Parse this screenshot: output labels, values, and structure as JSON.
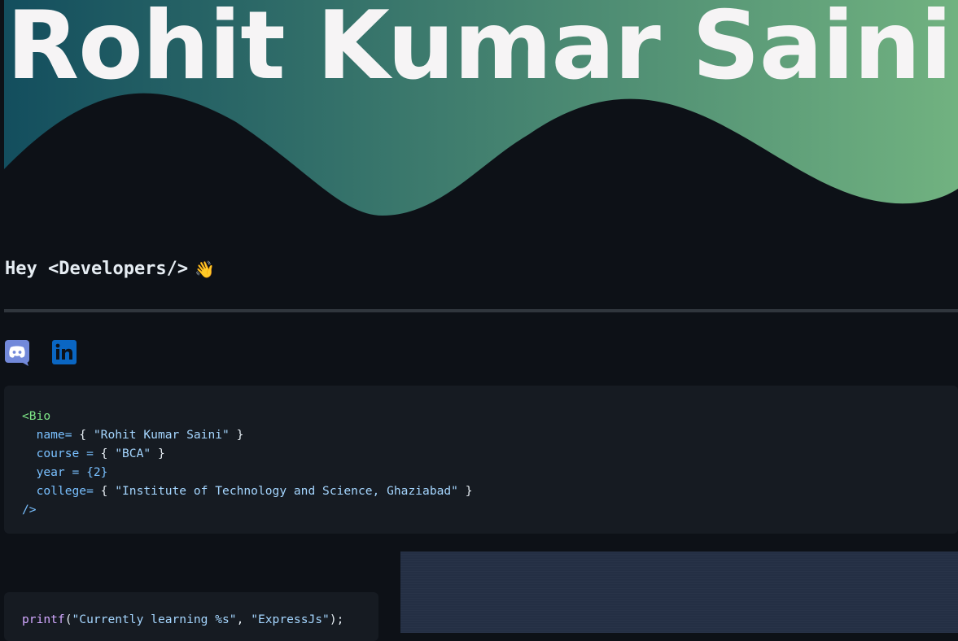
{
  "banner": {
    "title": "Rohit Kumar Saini",
    "gradient_start": "#134e5e",
    "gradient_end": "#71b280"
  },
  "greeting": {
    "text": "Hey <Developers/>",
    "icon": "waving-hand-icon"
  },
  "social": {
    "discord_icon": "discord-icon",
    "discord_color": "#7289da",
    "linkedin_icon": "linkedin-icon",
    "linkedin_color": "#0a66c2"
  },
  "bio": {
    "open_tag": "<Bio",
    "name_key": "name=",
    "name_value": "\"Rohit Kumar Saini\"",
    "course_key": "course =",
    "course_value": "\"BCA\"",
    "year_key": "year =",
    "year_value": "{2}",
    "college_key": "college=",
    "college_value": "\"Institute of Technology and Science, Ghaziabad\"",
    "close_tag": "/>"
  },
  "learning": {
    "fn": "printf",
    "format": "\"Currently learning %s\"",
    "arg": "\"ExpressJs\"",
    "end": ");"
  }
}
